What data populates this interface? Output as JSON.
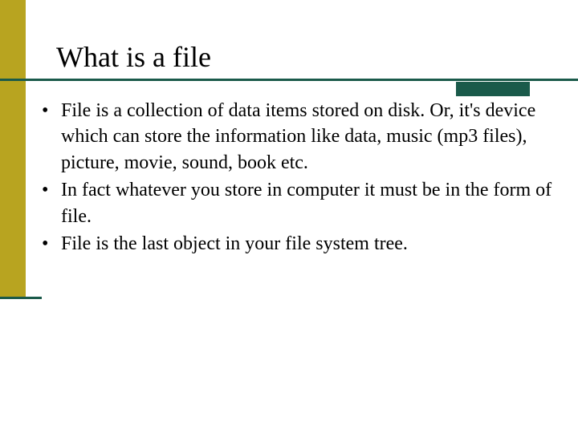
{
  "slide": {
    "title": "What is a file",
    "bullets": [
      "File is a collection of data items stored on disk. Or, it's device which can store the information like data, music (mp3 files), picture, movie, sound, book etc.",
      " In fact whatever you store in computer it must be in the form of file.",
      "File is the last object in your file system tree."
    ]
  },
  "colors": {
    "accent_green": "#1a5a4a",
    "accent_olive": "#b8a420"
  }
}
